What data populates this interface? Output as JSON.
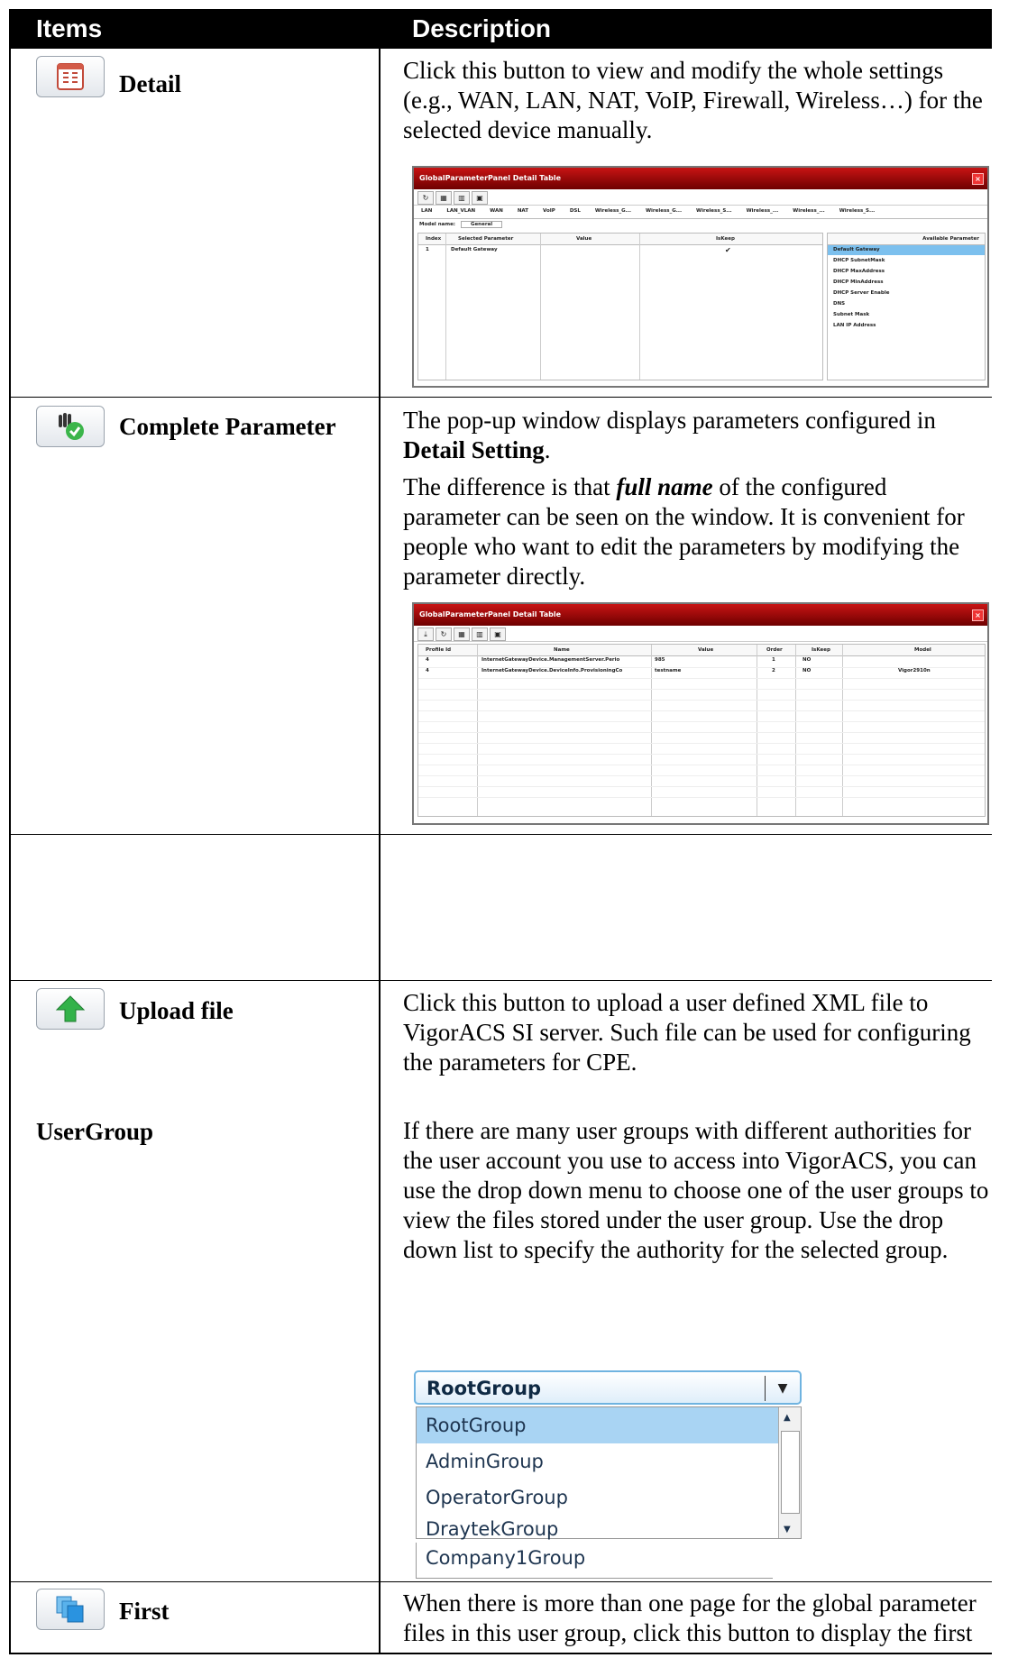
{
  "header": {
    "col1": "Items",
    "col2": "Description"
  },
  "rows": {
    "detail": {
      "name": "Detail",
      "desc": "Click this button to view and modify the whole settings (e.g., WAN, LAN, NAT, VoIP, Firewall, Wireless…) for the selected device manually."
    },
    "complete": {
      "name": "Complete Parameter",
      "desc1_a": "The pop-up window displays parameters configured in ",
      "desc1_b": "Detail Setting",
      "desc1_c": ".",
      "desc2_a": "The difference is that ",
      "desc2_b": "full name",
      "desc2_c": " of the configured parameter can be seen on the window. It is convenient for people who want to edit the parameters by modifying the parameter directly."
    },
    "upload": {
      "name": "Upload file",
      "desc": "Click this button to upload a user defined XML file to VigorACS SI server. Such file can be used for configuring the parameters for CPE."
    },
    "usergroup": {
      "name": "UserGroup",
      "desc": "If there are many user groups with different authorities for the user account you use to access into VigorACS, you can use the drop down menu to choose one of the user groups to view the files stored under the user group. Use the drop down list to specify the authority for the selected group."
    },
    "first": {
      "name": "First",
      "desc": "When there is more than one page for the global parameter files in this user group, click this button to display the first page."
    }
  },
  "detail_dialog": {
    "title": "GlobalParameterPanel Detail Table",
    "tabs": [
      "LAN",
      "LAN_VLAN",
      "WAN",
      "NAT",
      "VoIP",
      "DSL",
      "Wireless_G...",
      "Wireless_G...",
      "Wireless_S...",
      "Wireless_...",
      "Wireless_...",
      "Wireless_S..."
    ],
    "model_label": "Model name:",
    "model_value": "General",
    "columns": [
      "Index",
      "Selected Parameter",
      "Value",
      "IsKeep"
    ],
    "rows": [
      {
        "index": "1",
        "param": "Default Gateway",
        "value": "",
        "iskeep": "✔"
      }
    ],
    "available_header": "Available Parameter",
    "available": [
      "Default Gateway",
      "DHCP SubnetMask",
      "DHCP MaxAddress",
      "DHCP MinAddress",
      "DHCP Server Enable",
      "DNS",
      "Subnet Mask",
      "LAN IP Address"
    ]
  },
  "complete_dialog": {
    "title": "GlobalParameterPanel Detail Table",
    "columns": [
      "Profile Id",
      "Name",
      "Value",
      "Order",
      "IsKeep",
      "Model"
    ],
    "rows": [
      {
        "id": "4",
        "name": "InternetGatewayDevice.ManagementServer.Perio",
        "value": "985",
        "order": "1",
        "iskeep": "NO",
        "model": ""
      },
      {
        "id": "4",
        "name": "InternetGatewayDevice.DeviceInfo.ProvisioningCo",
        "value": "testname",
        "order": "2",
        "iskeep": "NO",
        "model": "Vigor2910n"
      }
    ]
  },
  "dropdown": {
    "selected": "RootGroup",
    "options": [
      "RootGroup",
      "AdminGroup",
      "OperatorGroup",
      "DraytekGroup",
      "Company1Group"
    ]
  }
}
